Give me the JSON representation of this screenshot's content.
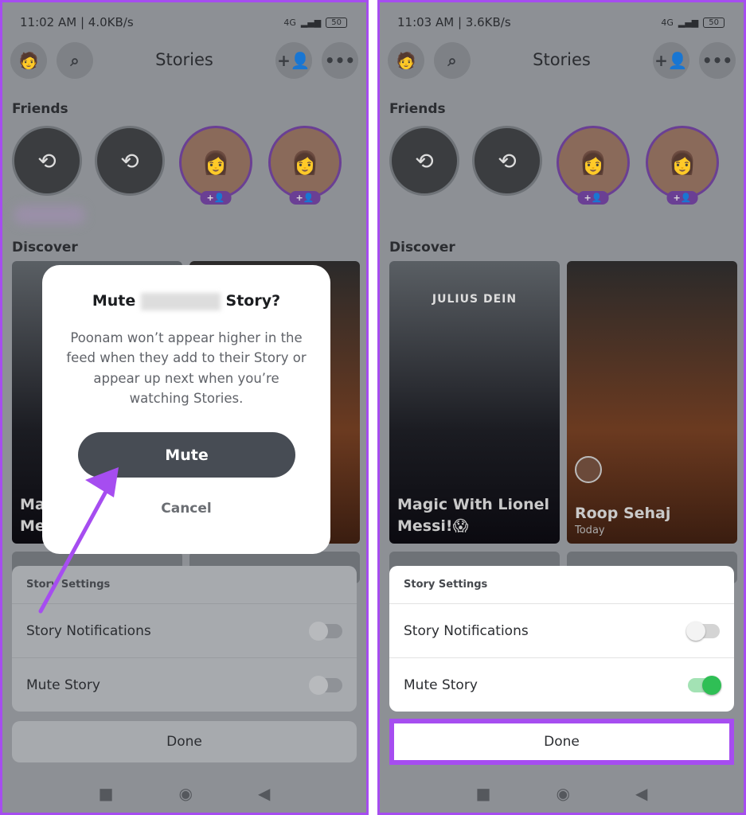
{
  "panels": [
    {
      "time": "11:02 AM | 4.0KB/s",
      "network": "4G",
      "battery": "50"
    },
    {
      "time": "11:03 AM | 3.6KB/s",
      "network": "4G",
      "battery": "50"
    }
  ],
  "header": {
    "title": "Stories"
  },
  "sections": {
    "friends": "Friends",
    "discover": "Discover"
  },
  "friends": {
    "add_badge": "+👤"
  },
  "discover": [
    {
      "brand": "JULIUS DEIN",
      "title": "Magic With Lionel Messi!😱"
    },
    {
      "title": "Roop Sehaj",
      "subtitle": "Today"
    }
  ],
  "sheet": {
    "heading": "Story Settings",
    "notifications": "Story Notifications",
    "mute": "Mute Story",
    "done": "Done",
    "left": {
      "notifications_on": false,
      "mute_on": false
    },
    "right": {
      "notifications_on": false,
      "mute_on": true
    }
  },
  "dialog": {
    "title_prefix": "Mute",
    "title_suffix": "Story?",
    "body": "Poonam won’t appear higher in the feed when they add to their Story or appear up next when you’re watching Stories.",
    "mute": "Mute",
    "cancel": "Cancel"
  },
  "colors": {
    "highlight": "#a64df0",
    "toggle_on": "#2fbf55",
    "mute_button": "#474c54"
  }
}
